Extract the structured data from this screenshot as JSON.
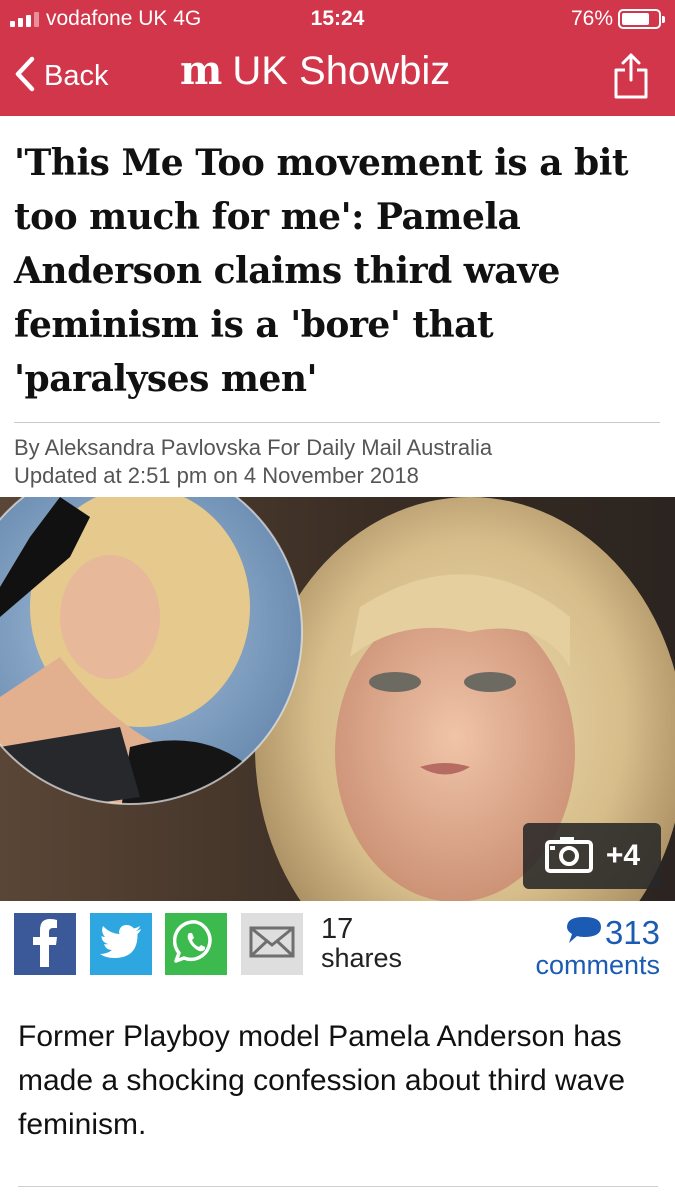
{
  "status_bar": {
    "carrier": "vodafone UK  4G",
    "time": "15:24",
    "battery": "76%",
    "battery_level": 0.76,
    "signal_bars": 3
  },
  "nav": {
    "back_label": "Back",
    "logo": "m",
    "title": "UK Showbiz"
  },
  "article": {
    "headline": "'This Me Too movement is a bit too much for me': Pamela Anderson claims third wave feminism is a 'bore' that 'paralyses men'",
    "byline": "By Aleksandra Pavlovska For Daily Mail Australia",
    "updated": "Updated at 2:51 pm on 4 November 2018",
    "gallery_count": "+4",
    "lead": "Former Playboy model Pamela Anderson has made a shocking confession about third wave feminism."
  },
  "social": {
    "shares_count": "17",
    "shares_label": "shares",
    "comments_count": "313",
    "comments_label": "comments"
  },
  "colors": {
    "brand": "#d2364a",
    "link": "#1b5bb3",
    "facebook": "#3b5998",
    "twitter": "#2ea7e0",
    "whatsapp": "#3dba4e"
  },
  "icons": [
    "signal-icon",
    "battery-icon",
    "back-chevron-icon",
    "share-icon",
    "camera-icon",
    "facebook-icon",
    "twitter-icon",
    "whatsapp-icon",
    "email-icon",
    "comment-bubble-icon"
  ]
}
